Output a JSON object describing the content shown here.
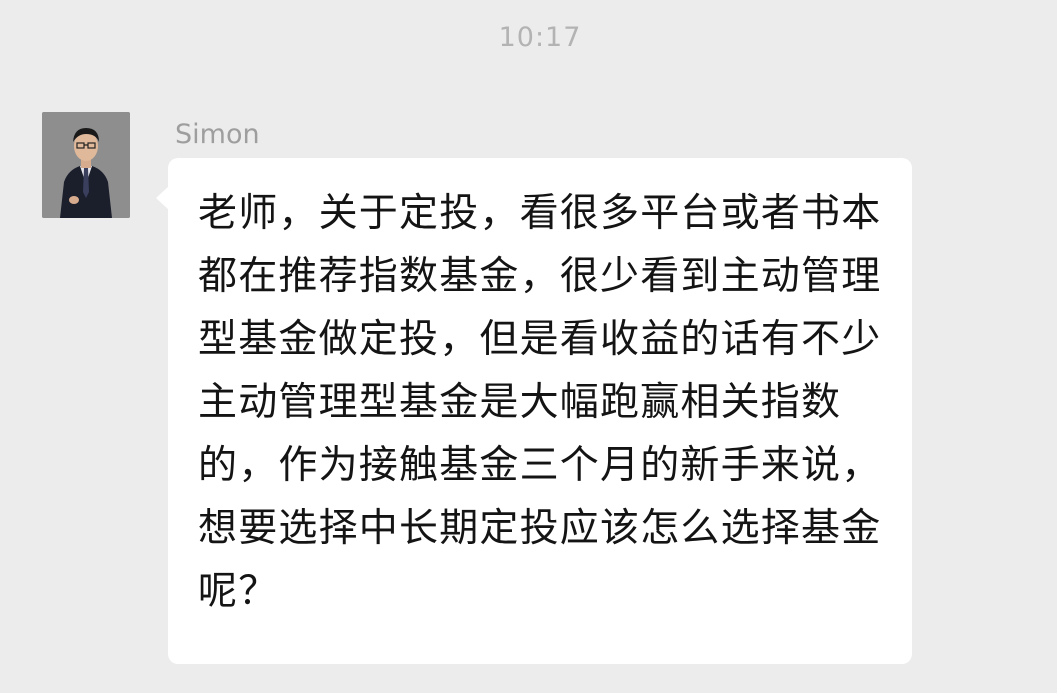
{
  "chat": {
    "timestamp": "10:17",
    "messages": [
      {
        "sender": "Simon",
        "avatar_icon": "user-portrait-icon",
        "text": "老师，关于定投，看很多平台或者书本都在推荐指数基金，很少看到主动管理型基金做定投，但是看收益的话有不少主动管理型基金是大幅跑赢相关指数的，作为接触基金三个月的新手来说，想要选择中长期定投应该怎么选择基金呢？"
      }
    ]
  },
  "colors": {
    "background": "#ececec",
    "bubble": "#ffffff",
    "timestamp": "#b3b3b3",
    "sender_name": "#9e9e9e",
    "message_text": "#141414"
  }
}
